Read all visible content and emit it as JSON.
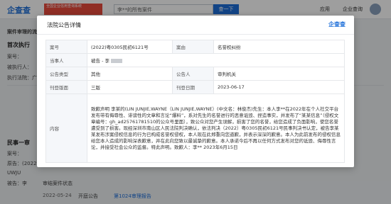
{
  "site": {
    "logo": "企查查",
    "badge": "全国企业信用查询系统",
    "search_value": "李**的所有案件",
    "search_button": "查一下",
    "top_links": [
      "应用",
      "企业查询"
    ]
  },
  "background": {
    "section_caption": "案件审理的流程",
    "section1_title": "首次执行",
    "section1_rows": [
      "案号：",
      "被执行人：",
      "执行法院：广东省"
    ],
    "section2_title": "民事一审",
    "section2_rows": [
      "案号：",
      "原告：(2022)",
      "UWJU",
      "被告：李"
    ],
    "section2_status": "审结案件状态",
    "timeline_date": "2022-05-24",
    "timeline_label": "开庭公告",
    "timeline_doc": "第1024审理报告"
  },
  "modal": {
    "title": "法院公告详情",
    "logo": "企查查",
    "rows": {
      "case_no_label": "案号",
      "case_no_value": "(2022)粤0305民初6121号",
      "cause_label": "案由",
      "cause_value": "名誉权纠纷",
      "party_label": "当事人",
      "party_value": "被告 - 李",
      "notice_type_label": "公告类型",
      "notice_type_value": "其他",
      "announcer_label": "公告人",
      "announcer_value": "审判机关",
      "layout_label": "刊登版面",
      "layout_value": "三版",
      "date_label": "刊登日期",
      "date_value": "2023-06-17",
      "content_label": "内容",
      "content_value": "致歉声明 李某的(LIN JUNJIE,WAYNE（LIN JUNJIE,WAYNE）(中文名：林俊杰)先生：本人李**在2022年在个人社交平台发布带有侮辱性、诽谤性的文章和言论“爆料”，系对先生的名誉进行的恶意诋毁、捏造事实，并发布了“某某信息”（侵权文章编号：gh_ad25761781510的公众号里面），致公众对您产生误解，损害了您的名誉，给您造成了负面影响，使您名誉遭受到了损害。现经深圳市南山区人民法院判决确认，依法判决（2022）粤0305民初6121号民事判决书认定，被告李某某发布涉案侵权信息的行为已构成名誉权侵权，本人现在此郑重向您道歉，并表示深深的歉意。本人为此前发布的侵权信息给您本人造成的影响深表歉意，并在此向您致以最诚挚的歉意。本人承诺今后不再以任何方式发布对您的诋毁、侮辱性言论，并接受社会公众的监督。特此声明。致歉人：李** 2023年6月15日"
    }
  }
}
